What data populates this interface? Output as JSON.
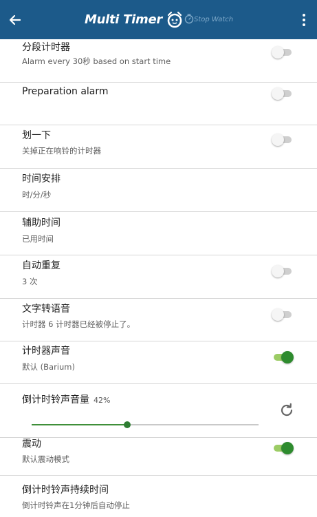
{
  "appbar": {
    "title": "Multi Timer",
    "subtitle": "Stop Watch",
    "color": "#1c5a8a"
  },
  "settings": [
    {
      "title": "分段计时器",
      "subtitle": "Alarm every 30秒 based on start time",
      "toggle": false
    },
    {
      "title": "Preparation alarm",
      "toggle": false
    },
    {
      "title": "划一下",
      "subtitle": "关掉正在响铃的计时器",
      "toggle": false
    },
    {
      "title": "时间安排",
      "subtitle": "时/分/秒"
    },
    {
      "title": "辅助时间",
      "subtitle": "已用时间"
    },
    {
      "title": "自动重复",
      "subtitle": "3 次",
      "toggle": false
    },
    {
      "title": "文字转语音",
      "subtitle": "计时器 6 计时器已经被停止了。",
      "toggle": false
    },
    {
      "title": "计时器声音",
      "subtitle": "默认 (Barium)",
      "toggle": true
    },
    {
      "title": "倒计时铃声音量",
      "value_label": "42%",
      "volume": 0.42
    },
    {
      "title": "震动",
      "subtitle": "默认震动模式",
      "toggle": true
    },
    {
      "title": "倒计时铃声持续时间",
      "subtitle": "倒计时铃声在1分钟后自动停止"
    }
  ],
  "colors": {
    "accent_green": "#2e8b2e",
    "switch_off_track": "#cfcfcf",
    "divider": "#d6d6d6"
  },
  "icons": {
    "back": "arrow-left-icon",
    "menu": "more-vert-icon",
    "brand": "alarm-clock-icon",
    "reset": "refresh-icon"
  }
}
